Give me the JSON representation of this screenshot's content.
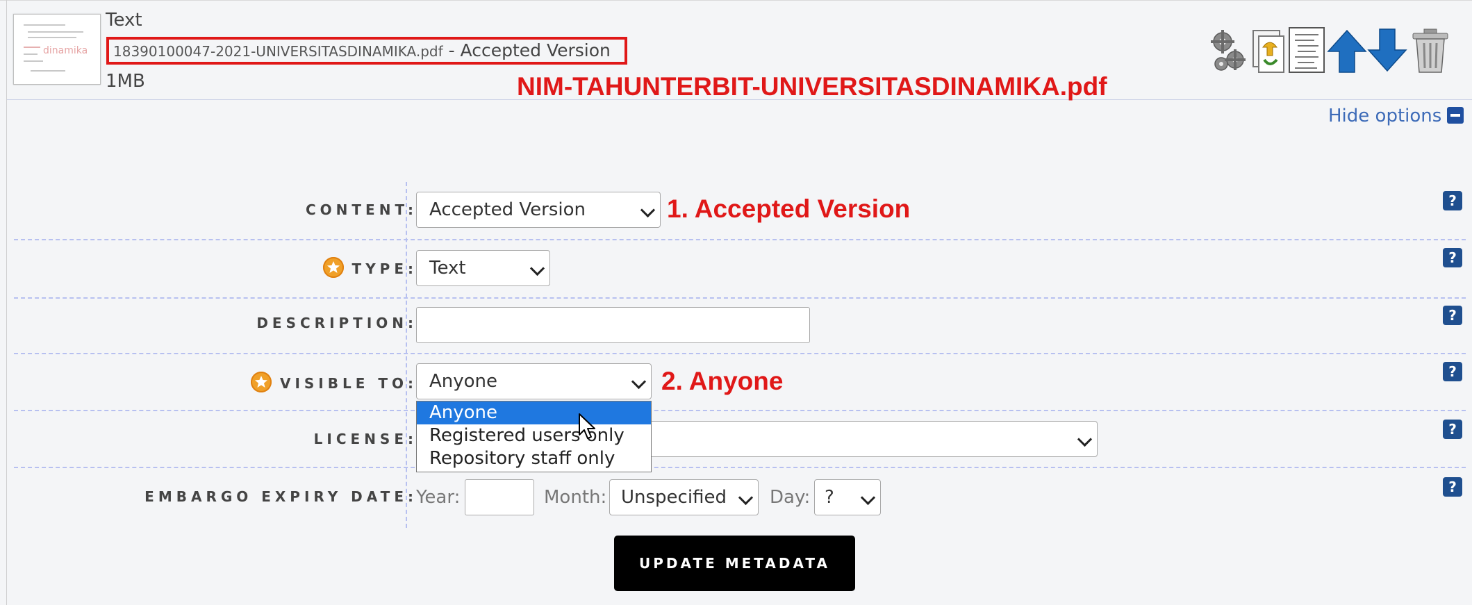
{
  "document": {
    "type": "Text",
    "filename": "18390100047-2021-UNIVERSITASDINAMIKA.pdf",
    "version_sep": " - Accepted Version",
    "size": "1MB",
    "thumbnail_logo": "dinamika"
  },
  "annotations": {
    "filename_format": "NIM-TAHUNTERBIT-UNIVERSITASDINAMIKA.pdf",
    "content_note": "1. Accepted Version",
    "visible_note": "2. Anyone"
  },
  "actions": [
    "gears-icon",
    "replace-file-icon",
    "document-list-icon",
    "move-up-icon",
    "move-down-icon",
    "trash-icon"
  ],
  "options_toggle": "Hide options",
  "form": {
    "content": {
      "label": "CONTENT:",
      "value": "Accepted Version"
    },
    "type": {
      "label": "TYPE:",
      "value": "Text"
    },
    "description": {
      "label": "DESCRIPTION:",
      "value": ""
    },
    "visible_to": {
      "label": "VISIBLE TO:",
      "value": "Anyone",
      "options": [
        "Anyone",
        "Registered users only",
        "Repository staff only"
      ]
    },
    "license": {
      "label": "LICENSE:",
      "value": ""
    },
    "embargo": {
      "label": "EMBARGO EXPIRY DATE:",
      "year_label": "Year:",
      "year_value": "",
      "month_label": "Month:",
      "month_value": "Unspecified",
      "day_label": "Day:",
      "day_value": "?"
    },
    "help_glyph": "?"
  },
  "update_button": "UPDATE METADATA",
  "colors": {
    "annotation": "#e01818",
    "link": "#3d6bb8",
    "selected_option": "#1f78e0",
    "help": "#1f4f8f"
  }
}
